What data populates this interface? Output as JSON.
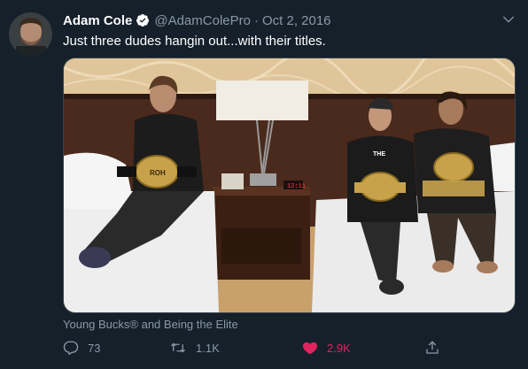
{
  "tweet": {
    "display_name": "Adam Cole",
    "handle": "@AdamColePro",
    "separator": "·",
    "date": "Oct 2, 2016",
    "text": "Just three dudes hangin out...with their titles.",
    "context": "Young Bucks® and Being the Elite",
    "verified": true
  },
  "actions": {
    "reply_count": "73",
    "retweet_count": "1.1K",
    "like_count": "2.9K",
    "liked": true
  },
  "colors": {
    "background": "#15202b",
    "secondary_text": "#8899a6",
    "verified_blue": "#1da1f2",
    "like_pink": "#e0245e"
  },
  "icons": [
    "verified-badge-icon",
    "caret-down-icon",
    "reply-icon",
    "retweet-icon",
    "heart-icon",
    "share-icon"
  ],
  "media": {
    "photo_badges": {
      "belt_left_label": "ROH",
      "shirt_label": "THE",
      "clock_text": "12:11"
    }
  }
}
